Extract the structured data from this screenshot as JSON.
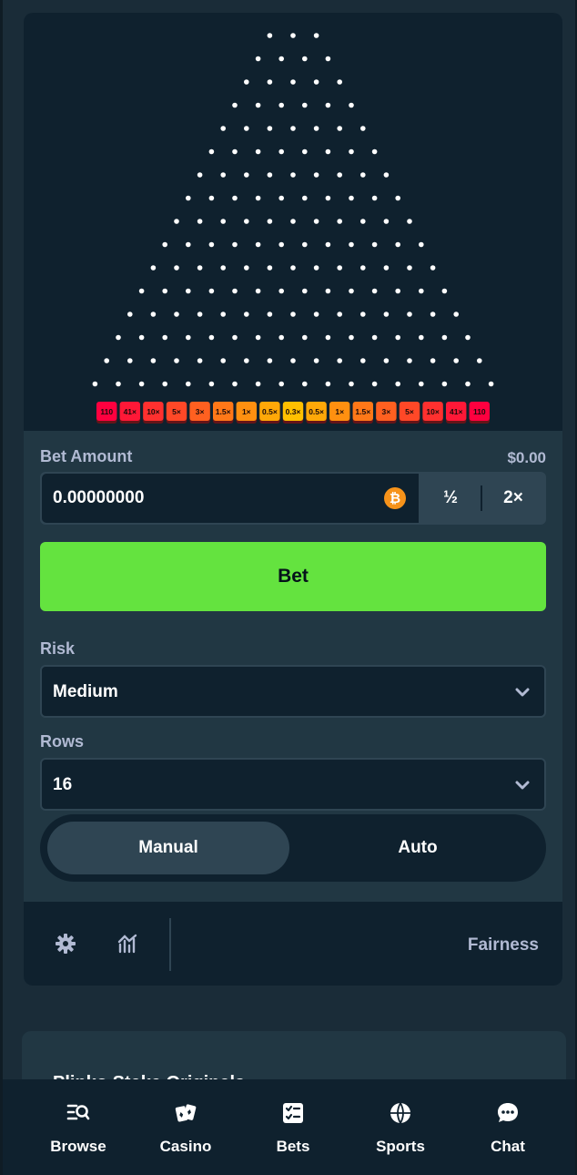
{
  "board": {
    "peg_rows": 16,
    "multipliers": [
      "110",
      "41×",
      "10×",
      "5×",
      "3×",
      "1.5×",
      "1×",
      "0.5×",
      "0.3×",
      "0.5×",
      "1×",
      "1.5×",
      "3×",
      "5×",
      "10×",
      "41×",
      "110"
    ],
    "multiplier_colors": [
      "#ff003f",
      "#ff1837",
      "#ff302f",
      "#ff4827",
      "#ff6020",
      "#ff7818",
      "#ff9010",
      "#ffa808",
      "#ffc000",
      "#ffa808",
      "#ff9010",
      "#ff7818",
      "#ff6020",
      "#ff4827",
      "#ff302f",
      "#ff1837",
      "#ff003f"
    ]
  },
  "bet": {
    "label": "Bet Amount",
    "usd_value": "$0.00",
    "amount": "0.00000000",
    "currency_icon": "bitcoin-icon",
    "half_label": "½",
    "double_label": "2×",
    "button_label": "Bet"
  },
  "risk": {
    "label": "Risk",
    "value": "Medium"
  },
  "rows": {
    "label": "Rows",
    "value": "16"
  },
  "mode": {
    "manual": "Manual",
    "auto": "Auto",
    "selected": "Manual"
  },
  "footer": {
    "fairness": "Fairness",
    "icons": [
      "gear-icon",
      "stats-icon"
    ]
  },
  "lower_card": {
    "title": "Plinko Stake Originals"
  },
  "nav": {
    "items": [
      {
        "label": "Browse",
        "icon": "browse-icon"
      },
      {
        "label": "Casino",
        "icon": "casino-icon"
      },
      {
        "label": "Bets",
        "icon": "bets-icon"
      },
      {
        "label": "Sports",
        "icon": "sports-icon"
      },
      {
        "label": "Chat",
        "icon": "chat-icon"
      }
    ]
  },
  "colors": {
    "accent_green": "#64e33f",
    "panel": "#213743",
    "dark": "#0f212e",
    "muted_text": "#b1bad3"
  }
}
